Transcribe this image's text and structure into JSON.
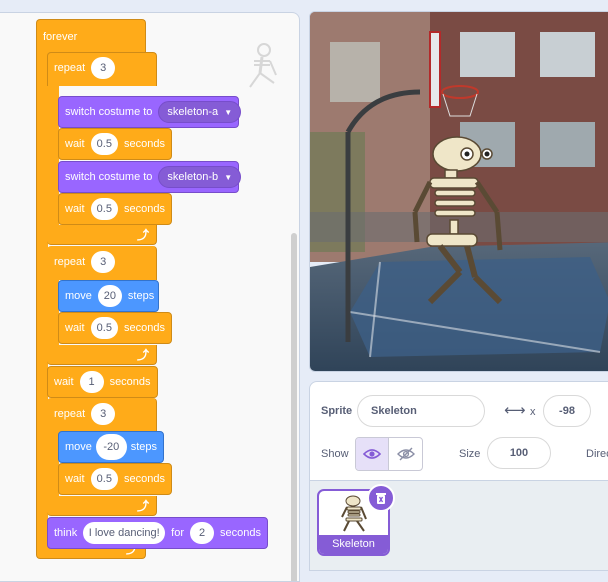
{
  "script": {
    "forever_label": "forever",
    "repeat_label": "repeat",
    "switch_costume_label": "switch costume to",
    "wait_label": "wait",
    "seconds_label": "seconds",
    "move_label": "move",
    "steps_label": "steps",
    "think_label": "think",
    "for_label": "for",
    "repeat1_count": "3",
    "costume_a": "skeleton-a",
    "wait1_value": "0.5",
    "costume_b": "skeleton-b",
    "wait2_value": "0.5",
    "repeat2_count": "3",
    "move1_value": "20",
    "wait3_value": "0.5",
    "wait4_value": "1",
    "repeat3_count": "3",
    "move2_value": "-20",
    "wait5_value": "0.5",
    "think_message": "I love dancing!",
    "think_seconds": "2"
  },
  "sprite_info": {
    "sprite_label": "Sprite",
    "sprite_name": "Skeleton",
    "x_label": "x",
    "x_value": "-98",
    "show_label": "Show",
    "size_label": "Size",
    "size_value": "100",
    "direction_label": "Direc"
  },
  "sprite_list": {
    "tiles": [
      {
        "name": "Skeleton"
      }
    ]
  },
  "icons": {
    "loop_arrow": "loop-arrow-icon",
    "dropdown_caret": "caret-down-icon",
    "x_arrows": "horizontal-arrows-icon",
    "show_visible": "eye-icon",
    "show_hidden": "eye-slash-icon",
    "delete": "trash-icon"
  },
  "colors": {
    "control": "#ffab19",
    "looks": "#9966ff",
    "motion": "#4c97ff",
    "selected": "#855cd6"
  }
}
